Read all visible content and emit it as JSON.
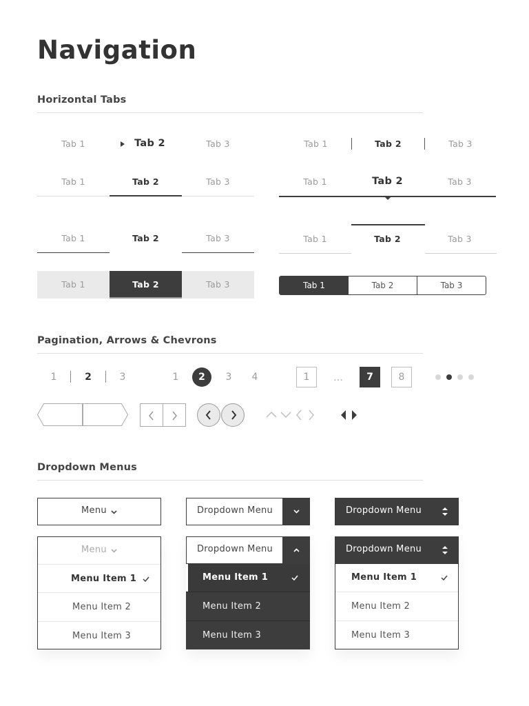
{
  "page": {
    "title": "Navigation"
  },
  "sections": {
    "tabs": "Horizontal Tabs",
    "pagination": "Pagination, Arrows & Chevrons",
    "dropdowns": "Dropdown Menus"
  },
  "tabs": {
    "t1": "Tab 1",
    "t2": "Tab 2",
    "t3": "Tab 3",
    "active_index": 2
  },
  "pagination": {
    "pager1": [
      "1",
      "2",
      "3"
    ],
    "pager2": [
      "1",
      "2",
      "3",
      "4"
    ],
    "pager3": [
      "1",
      "…",
      "7",
      "8"
    ],
    "pager1_active": "2",
    "pager2_active": "2",
    "pager3_active": "7",
    "dots_total": 4,
    "dots_active": 2
  },
  "dropdowns": {
    "menu_label": "Menu",
    "dropdown_label": "Dropdown Menu",
    "items": [
      "Menu Item 1",
      "Menu Item 2",
      "Menu Item 3"
    ],
    "selected_item": "Menu Item 1"
  },
  "colors": {
    "dark": "#3d3d3d",
    "muted": "#9a9a9a",
    "border": "#bcbcbc",
    "light": "#eaeaea"
  },
  "icons": [
    "caret-right-icon",
    "chevron-left-icon",
    "chevron-right-icon",
    "chevron-up-icon",
    "chevron-down-icon",
    "caret-left-icon",
    "check-icon",
    "sort-icon"
  ]
}
